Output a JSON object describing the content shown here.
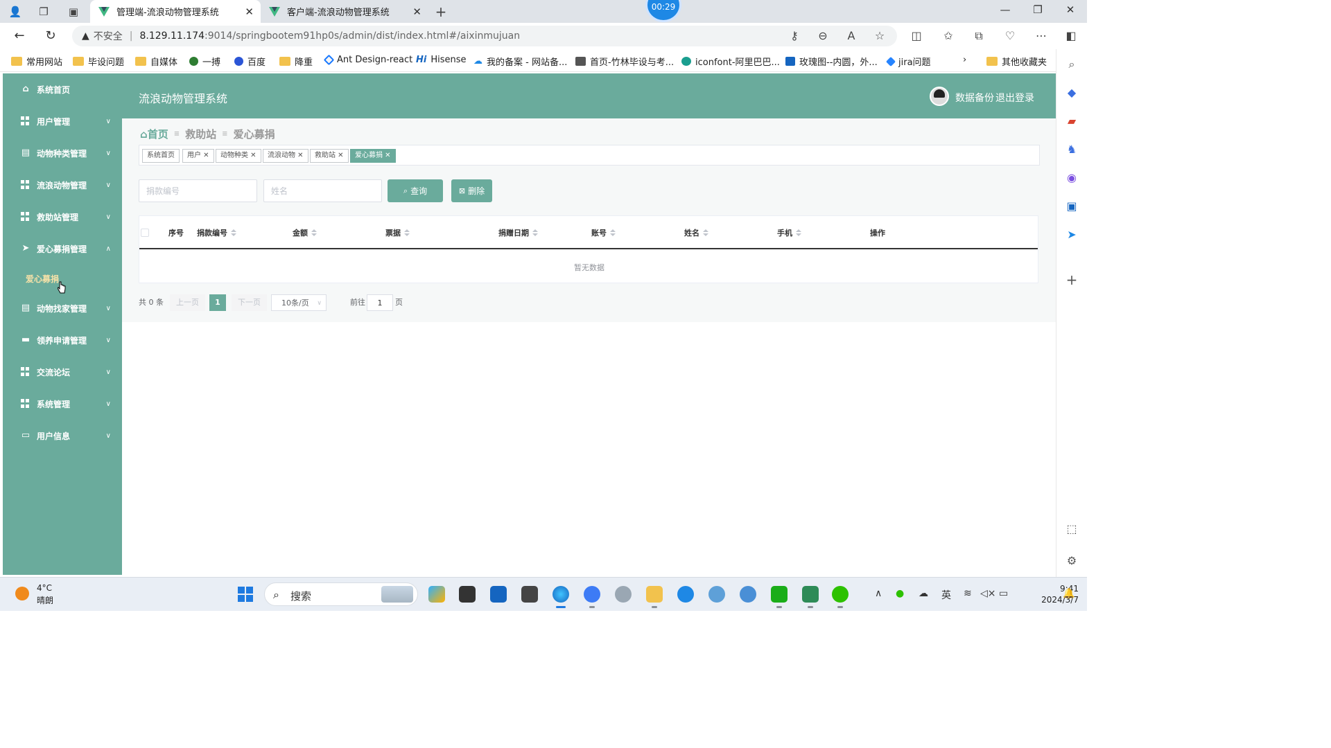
{
  "browser": {
    "tabs": [
      {
        "title": "管理端-流浪动物管理系统",
        "active": true
      },
      {
        "title": "客户端-流浪动物管理系统",
        "active": false
      }
    ],
    "timer": "00:29",
    "address": {
      "warning": "不安全",
      "host": "8.129.11.174",
      "path": ":9014/springbootem91hp0s/admin/dist/index.html#/aixinmujuan"
    },
    "bookmarks": [
      "常用网站",
      "毕设问题",
      "自媒体",
      "一搏",
      "百度",
      "降重",
      "Ant Design-react",
      "Hisense",
      "我的备案 - 网站备...",
      "首页-竹林毕设与考...",
      "iconfont-阿里巴巴...",
      "玫瑰图--内圆，外...",
      "jira问题"
    ],
    "other_bookmarks": "其他收藏夹"
  },
  "app": {
    "title": "流浪动物管理系统",
    "header_links": {
      "backup": "数据备份",
      "logout": "退出登录"
    },
    "sidebar": {
      "items": [
        {
          "label": "系统首页",
          "icon": "home-icon",
          "expandable": false
        },
        {
          "label": "用户管理",
          "icon": "grid-icon",
          "expandable": true
        },
        {
          "label": "动物种类管理",
          "icon": "clipboard-icon",
          "expandable": true
        },
        {
          "label": "流浪动物管理",
          "icon": "grid-icon",
          "expandable": true
        },
        {
          "label": "救助站管理",
          "icon": "grid-icon",
          "expandable": true
        },
        {
          "label": "爱心募捐管理",
          "icon": "send-icon",
          "expandable": true,
          "expanded": true
        },
        {
          "label": "动物找家管理",
          "icon": "clipboard-icon",
          "expandable": true
        },
        {
          "label": "领养申请管理",
          "icon": "comment-icon",
          "expandable": true
        },
        {
          "label": "交流论坛",
          "icon": "grid-icon",
          "expandable": true
        },
        {
          "label": "系统管理",
          "icon": "grid-icon",
          "expandable": true
        },
        {
          "label": "用户信息",
          "icon": "card-icon",
          "expandable": true
        }
      ],
      "subitem": "爱心募捐"
    },
    "breadcrumb": [
      "首页",
      "救助站",
      "爱心募捐"
    ],
    "tags": [
      "系统首页",
      "用户",
      "动物种类",
      "流浪动物",
      "救助站",
      "爱心募捐"
    ],
    "search": {
      "donation_no_placeholder": "捐款编号",
      "name_placeholder": "姓名",
      "query_label": "查询",
      "delete_label": "删除"
    },
    "table": {
      "columns": [
        "序号",
        "捐款编号",
        "金额",
        "票据",
        "捐赠日期",
        "账号",
        "姓名",
        "手机",
        "操作"
      ],
      "rows": [],
      "empty_text": "暂无数据"
    },
    "pagination": {
      "total": "共 0 条",
      "prev": "上一页",
      "current": "1",
      "next": "下一页",
      "page_size": "10条/页",
      "goto_label": "前往",
      "goto_value": "1",
      "page_unit": "页"
    }
  },
  "taskbar": {
    "weather": {
      "temp": "4°C",
      "desc": "晴朗"
    },
    "search_label": "搜索",
    "ime": "英",
    "time": "9:41",
    "date": "2024/3/7"
  }
}
